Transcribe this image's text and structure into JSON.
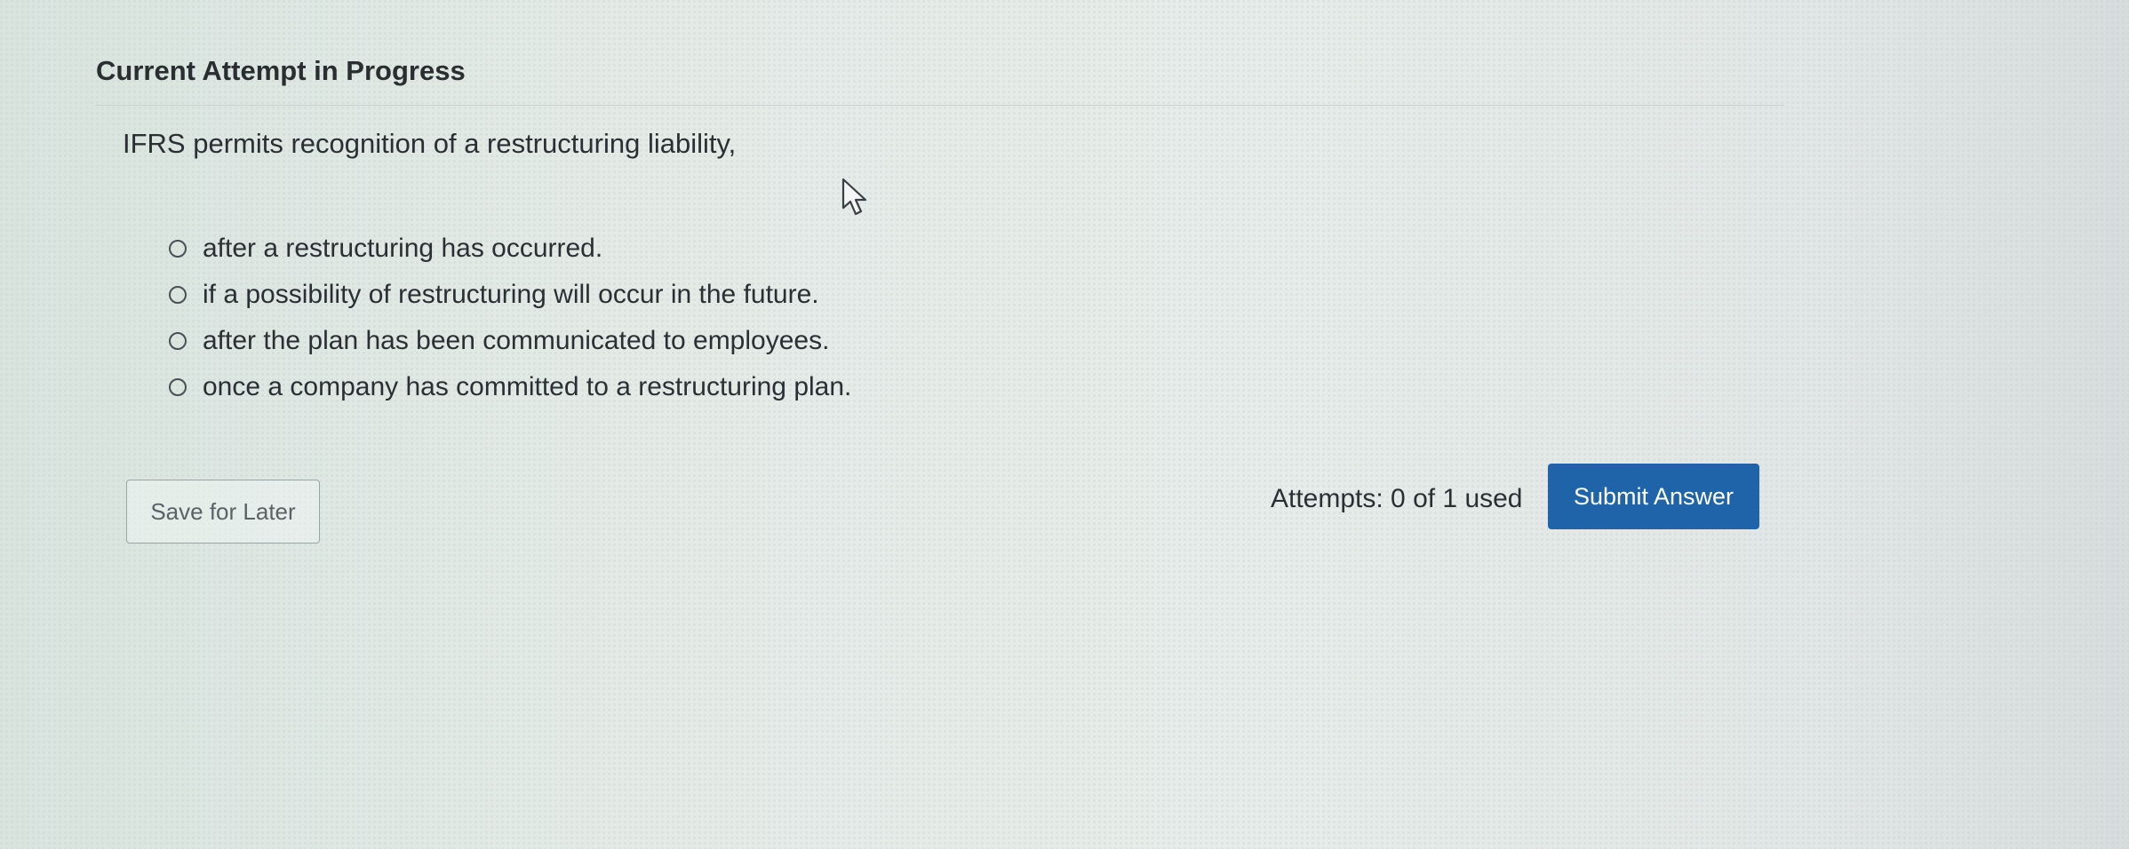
{
  "section": {
    "title": "Current Attempt in Progress"
  },
  "question": {
    "text": "IFRS permits recognition of a restructuring liability,",
    "options": [
      {
        "label": "after a restructuring has occurred."
      },
      {
        "label": "if a possibility of restructuring will occur in the future."
      },
      {
        "label": "after the plan has been communicated to employees."
      },
      {
        "label": "once a company has committed to a restructuring plan."
      }
    ]
  },
  "footer": {
    "save_label": "Save for Later",
    "attempts_text": "Attempts: 0 of 1 used",
    "submit_label": "Submit Answer"
  },
  "colors": {
    "primary_button": "#1f63a8",
    "text": "#2b2f33"
  }
}
